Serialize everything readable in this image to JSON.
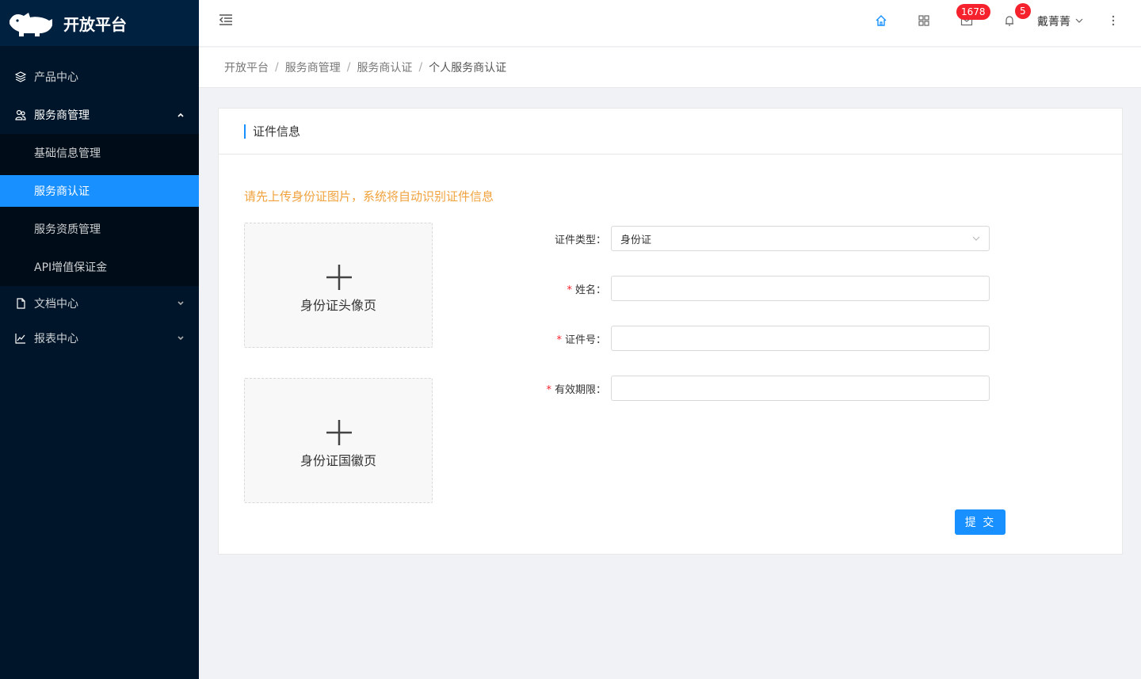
{
  "app": {
    "title": "开放平台"
  },
  "sidebar": {
    "items": [
      {
        "label": "产品中心",
        "icon": "layers-icon"
      },
      {
        "label": "服务商管理",
        "icon": "users-icon",
        "expanded": true,
        "children": [
          {
            "label": "基础信息管理"
          },
          {
            "label": "服务商认证",
            "active": true
          },
          {
            "label": "服务资质管理"
          },
          {
            "label": "API增值保证金"
          }
        ]
      },
      {
        "label": "文档中心",
        "icon": "file-icon"
      },
      {
        "label": "报表中心",
        "icon": "chart-line-icon"
      }
    ]
  },
  "header": {
    "mail_badge": "1678",
    "bell_badge": "5",
    "user_name": "戴菁菁"
  },
  "breadcrumb": [
    "开放平台",
    "服务商管理",
    "服务商认证",
    "个人服务商认证"
  ],
  "breadcrumb_separator": "/",
  "card": {
    "title": "证件信息",
    "tip": "请先上传身份证图片，系统将自动识别证件信息",
    "uploads": {
      "front_label": "身份证头像页",
      "back_label": "身份证国徽页"
    },
    "form": {
      "id_type_label": "证件类型：",
      "id_type_value": "身份证",
      "required_mark": "*",
      "name_label": "姓名：",
      "name_value": "",
      "id_number_label": "证件号：",
      "id_number_value": "",
      "validity_label": "有效期限：",
      "validity_value": ""
    },
    "submit_label": "提 交"
  },
  "colors": {
    "sidebar_bg": "#001529",
    "accent": "#1890ff",
    "tip": "#f0a23c",
    "badge": "#f5222d"
  }
}
